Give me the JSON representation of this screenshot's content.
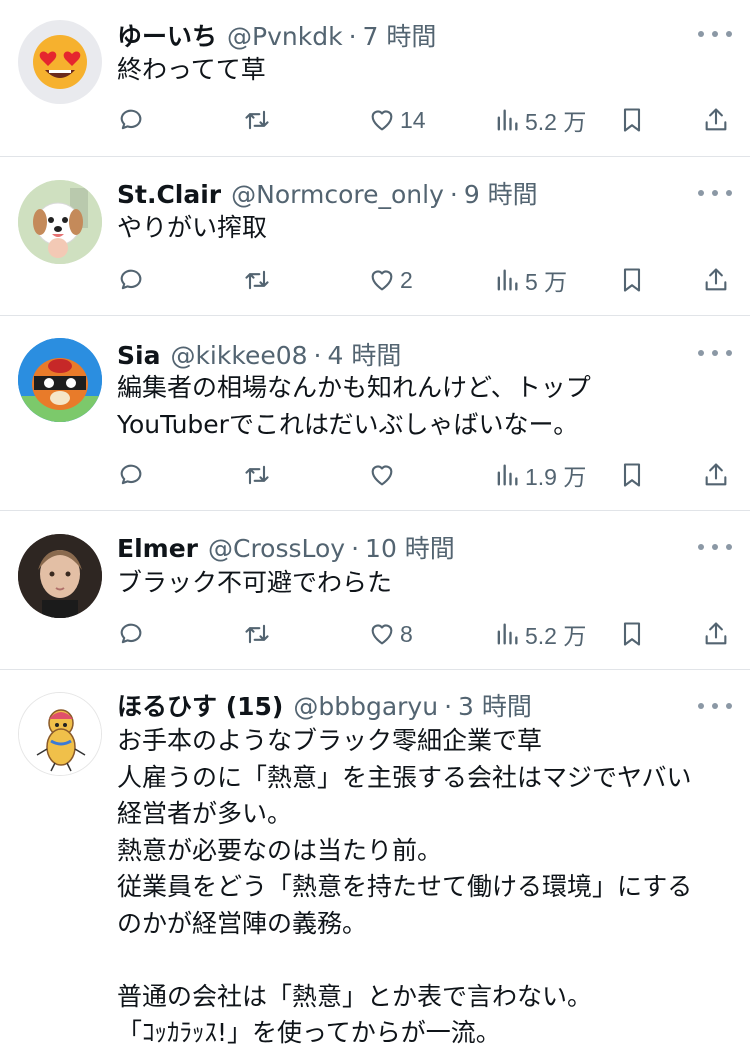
{
  "colors": {
    "text": "#0f1419",
    "muted": "#536471",
    "divider": "#e1e4e8"
  },
  "tweets": [
    {
      "name": "ゆーいち",
      "handle": "@Pvnkdk",
      "dot": "·",
      "time": "7 時間",
      "text": "終わってて草",
      "avatar_icon": "heart-eyes-emoji-icon",
      "likes": "14",
      "views": "5.2 万"
    },
    {
      "name": "St.Clair",
      "handle": "@Normcore_only",
      "dot": "·",
      "time": "9 時間",
      "text": "やりがい搾取",
      "avatar_icon": "white-dog-icon",
      "likes": "2",
      "views": "5 万"
    },
    {
      "name": "Sia",
      "handle": "@kikkee08",
      "dot": "·",
      "time": "4 時間",
      "text": "編集者の相場なんかも知れんけど、トップ\nYouTuberでこれはだいぶしゃばいなー。",
      "avatar_icon": "masked-raccoon-icon",
      "likes": "",
      "views": "1.9 万"
    },
    {
      "name": "Elmer",
      "handle": "@CrossLoy",
      "dot": "·",
      "time": "10 時間",
      "text": "ブラック不可避でわらた",
      "avatar_icon": "person-photo-icon",
      "likes": "8",
      "views": "5.2 万"
    },
    {
      "name": "ほるひす (15)",
      "handle": "@bbbgaryu",
      "dot": "·",
      "time": "3 時間",
      "text": "お手本のようなブラック零細企業で草\n人雇うのに「熱意」を主張する会社はマジでヤバい\n経営者が多い。\n熱意が必要なのは当たり前。\n従業員をどう「熱意を持たせて働ける環境」にする\nのかが経営陣の義務。\n\n普通の会社は「熱意」とか表で言わない。\n「ｺｯｶﾗｯｽ!」を使ってからが一流。",
      "avatar_icon": "peanut-drawing-icon"
    }
  ]
}
